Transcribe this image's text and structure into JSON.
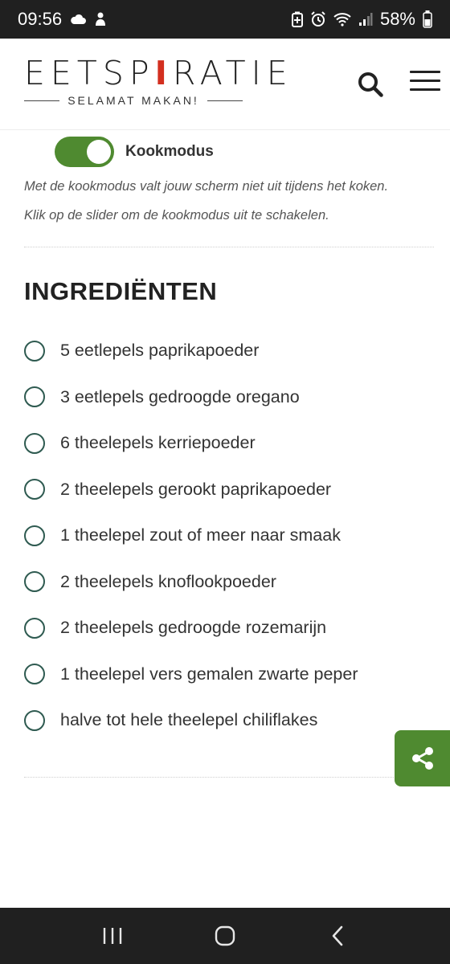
{
  "status_bar": {
    "time": "09:56",
    "battery": "58%",
    "left_icons": [
      "cloud-icon",
      "notification-icon"
    ],
    "right_icons": [
      "battery-saver-icon",
      "alarm-icon",
      "wifi-icon",
      "signal-icon",
      "battery-icon"
    ]
  },
  "header": {
    "logo_pre": "EETSP",
    "logo_mid": "I",
    "logo_post": "RATIE",
    "logo_tagline": "SELAMAT MAKAN!",
    "icons": [
      "search-icon",
      "hamburger-menu-icon"
    ]
  },
  "cook_mode": {
    "label": "Kookmodus",
    "enabled": true,
    "description_1": "Met de kookmodus valt jouw scherm niet uit tijdens het koken.",
    "description_2": "Klik op de slider om de kookmodus uit te schakelen."
  },
  "ingredients": {
    "title": "INGREDIËNTEN",
    "items": [
      "5 eetlepels paprikapoeder",
      "3 eetlepels gedroogde oregano",
      "6 theelepels kerriepoeder",
      "2 theelepels gerookt paprikapoeder",
      "1 theelepel zout of meer naar smaak",
      "2 theelepels knoflookpoeder",
      "2 theelepels gedroogde rozemarijn",
      "1 theelepel vers gemalen zwarte peper",
      "halve tot hele theelepel chiliflakes"
    ]
  },
  "share": {
    "icon": "share-icon"
  },
  "nav_bar": {
    "icons": [
      "recents-icon",
      "home-icon",
      "back-icon"
    ]
  },
  "colors": {
    "accent_green": "#4f8a30",
    "checkbox_border": "#2e5a50",
    "system_bar": "#202020"
  }
}
